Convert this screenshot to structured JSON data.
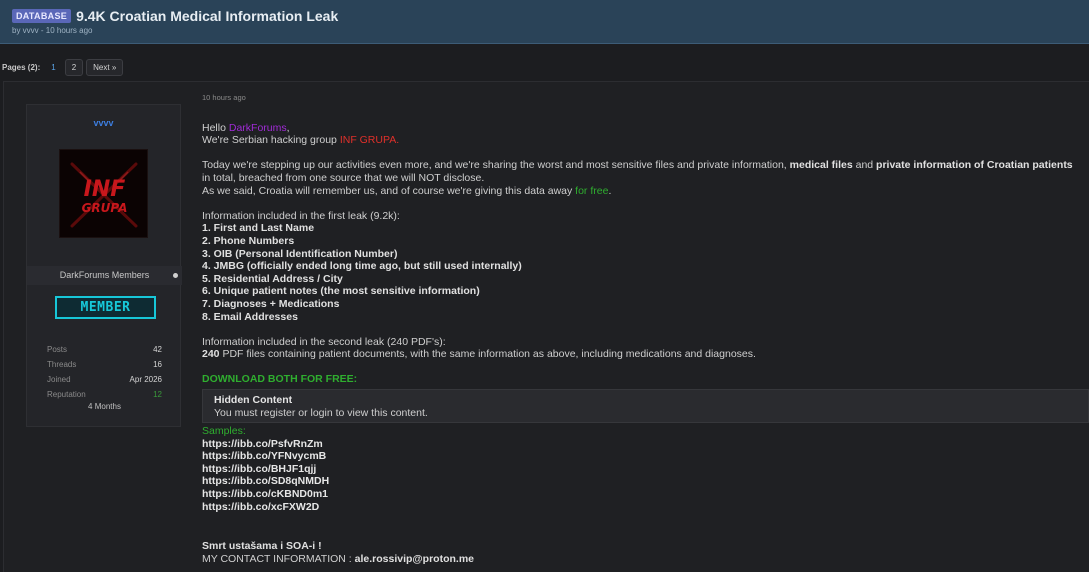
{
  "thread": {
    "prefix": "DATABASE",
    "title": "9.4K Croatian Medical Information Leak",
    "byline": "by vvvv - 10 hours ago"
  },
  "pager": {
    "label": "Pages (2):",
    "pages": [
      "1",
      "2"
    ],
    "next": "Next »"
  },
  "author": {
    "username": "vvvv",
    "avatar_text_1": "INF",
    "avatar_text_2": "GRUPA",
    "usergroup": "DarkForums Members",
    "badge": "MEMBER",
    "stats": [
      {
        "label": "Posts",
        "value": "42"
      },
      {
        "label": "Threads",
        "value": "16"
      },
      {
        "label": "Joined",
        "value": "Apr 2026"
      },
      {
        "label": "Reputation",
        "value": "12"
      }
    ],
    "months": "4 Months"
  },
  "post": {
    "timestamp": "10 hours ago",
    "greeting_pre": "Hello ",
    "greeting_name": "DarkForums",
    "greeting_post": ",",
    "intro_pre": "We're Serbian hacking group ",
    "intro_group": "INF GRUPA.",
    "p1_a": "Today we're stepping up our activities even more, and we're sharing the worst and most sensitive files and private information, ",
    "p1_b": "medical files",
    "p1_c": " and ",
    "p1_d": "private information of Croatian patients",
    "p2": "in total, breached from one source that we will NOT disclose.",
    "p3_a": "As we said, Croatia will remember us, and of course we're giving this data away ",
    "p3_b": "for free",
    "p3_c": ".",
    "leak1_heading": "Information included in the first leak (9.2k):",
    "leak1_items": [
      "1. First and Last Name",
      "2. Phone Numbers",
      "3. OIB (Personal Identification Number)",
      "4. JMBG (officially ended long time ago, but still used internally)",
      "5. Residential Address / City",
      "6. Unique patient notes (the most sensitive information)",
      "7. Diagnoses + Medications",
      "8. Email Addresses"
    ],
    "leak2_heading": "Information included in the second leak (240 PDF's):",
    "leak2_count": "240",
    "leak2_text": " PDF files containing patient documents, with the same information as above, including medications and diagnoses.",
    "download": "DOWNLOAD BOTH FOR FREE:",
    "hidden_title": "Hidden Content",
    "hidden_sub": "You must register or login to view this content.",
    "samples_label": "Samples:",
    "samples": [
      "https://ibb.co/PsfvRnZm",
      "https://ibb.co/YFNvycmB",
      "https://ibb.co/BHJF1qjj",
      "https://ibb.co/SD8qNMDH",
      "https://ibb.co/cKBND0m1",
      "https://ibb.co/xcFXW2D"
    ],
    "sign_1": "Smrt ustašama i SOA-i !",
    "contact_label": "MY CONTACT INFORMATION : ",
    "contact_value": "ale.rossivip@proton.me"
  }
}
